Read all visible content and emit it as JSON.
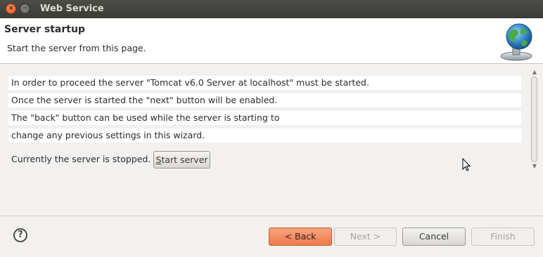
{
  "window": {
    "title": "Web Service",
    "close_glyph": "×",
    "minimize_glyph": "−"
  },
  "header": {
    "title": "Server startup",
    "description": "Start the server from this page.",
    "icon": "globe-server-icon"
  },
  "content": {
    "lines": [
      "In order to proceed the server \"Tomcat v6.0 Server at localhost\" must be started.",
      "Once the server is started the \"next\" button will be enabled.",
      "The \"back\" button can be used while the server is starting to",
      "change any previous settings in this wizard."
    ],
    "status": "Currently the server is stopped.",
    "start_button_mnemonic": "S",
    "start_button_rest": "tart server"
  },
  "footer": {
    "help_glyph": "?",
    "back_label": "< Back",
    "next_label": "Next >",
    "cancel_label": "Cancel",
    "finish_label": "Finish"
  },
  "colors": {
    "accent": "#ef7a4c",
    "titlebar": "#3b3b37",
    "background": "#f2f1f0"
  }
}
